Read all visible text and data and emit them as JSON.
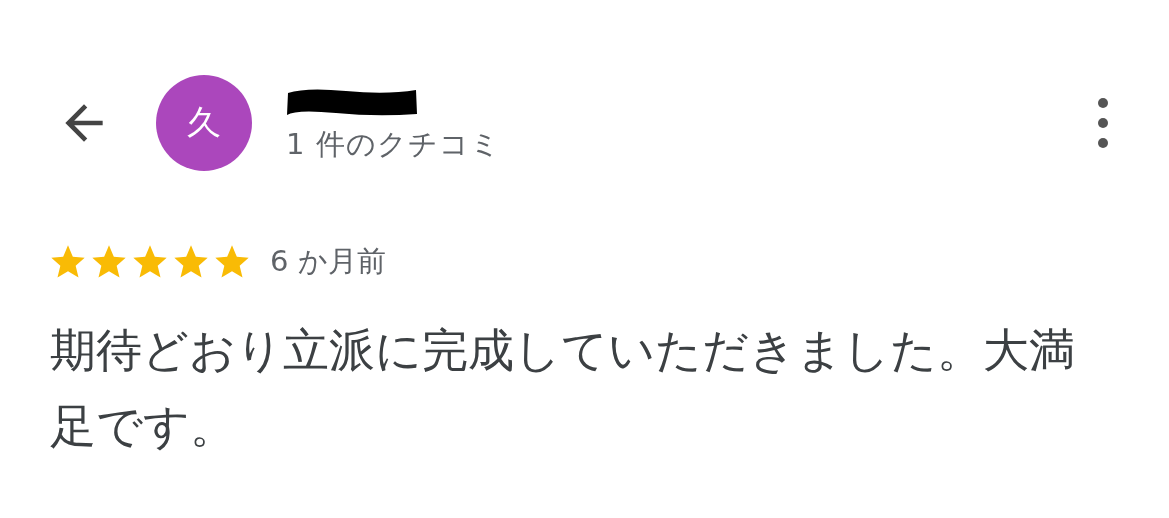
{
  "reviewer": {
    "avatar_letter": "久",
    "review_count": "1 件のクチコミ"
  },
  "review": {
    "stars": 5,
    "time": "6 か月前",
    "text": "期待どおり立派に完成していただきました。大満足です。"
  }
}
